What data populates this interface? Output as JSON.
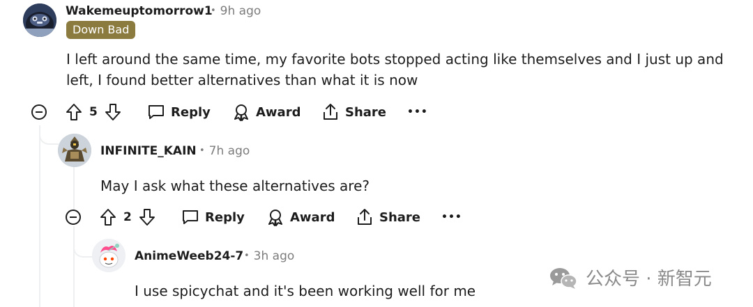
{
  "comments": [
    {
      "username": "Wakemeuptomorrow1",
      "time": "9h ago",
      "flair": "Down Bad",
      "body": "I left around the same time, my favorite bots stopped acting like themselves and I just up and left, I found better alternatives than what it is now",
      "votes": "5",
      "actions": {
        "reply": "Reply",
        "award": "Award",
        "share": "Share",
        "more": "•••"
      }
    },
    {
      "username": "INFINITE_KAIN",
      "time": "7h ago",
      "body": "May I ask what these alternatives are?",
      "votes": "2",
      "actions": {
        "reply": "Reply",
        "award": "Award",
        "share": "Share",
        "more": "•••"
      }
    },
    {
      "username": "AnimeWeeb24-7",
      "time": "3h ago",
      "body": "I use spicychat and it's been working well for me"
    }
  ],
  "separator": "•",
  "watermark": "公众号 · 新智元",
  "colors": {
    "flair_bg": "#8c7b3f",
    "meta": "#7c7c7c",
    "thread_line": "#edeff1"
  },
  "icons": [
    "upvote-icon",
    "downvote-icon",
    "reply-icon",
    "award-icon",
    "share-icon",
    "collapse-icon",
    "wechat-icon"
  ]
}
